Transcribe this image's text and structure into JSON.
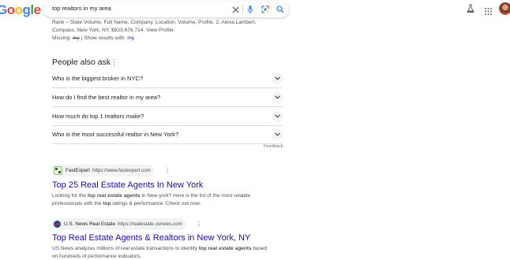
{
  "header": {
    "logo_letters": [
      "G",
      "o",
      "o",
      "g",
      "l",
      "e"
    ],
    "logo_colors": [
      "#4285F4",
      "#EA4335",
      "#FBBC05",
      "#4285F4",
      "#34A853",
      "#EA4335"
    ],
    "query": "top realtors in my area",
    "icons": [
      "close-icon",
      "microphone-icon",
      "lens-icon",
      "search-icon",
      "labs-flask-icon",
      "apps-grid-icon"
    ]
  },
  "snippet": {
    "line1": "Rank – State Volume, Full Name, Company, Location, Volume, Profile. 2, Alexa Lambert,",
    "line2": "Compass, New York, NY, $923,676,714, View Profile.",
    "missing_label": "Missing:",
    "missing_term": "my",
    "show_results": "| Show results with:",
    "show_link": "my"
  },
  "paa": {
    "title": "People also ask",
    "questions": [
      "Who is the biggest broker in NYC?",
      "How do I find the best realtor in my area?",
      "How much do top 1 realtors make?",
      "Who is the most successful realtor in New York?"
    ],
    "feedback": "Feedback"
  },
  "results": [
    {
      "source_name": "FastExpert",
      "source_url": "https://www.fastexpert.com",
      "title": "Top 25 Real Estate Agents In New York",
      "snippet_line1_pre": "Looking for the ",
      "snippet_line1_bold": "top real estate agents",
      "snippet_line1_post": " in New-york? Here is the list of the most reliable",
      "snippet_line2_pre": "professionals with the ",
      "snippet_line2_bold": "top",
      "snippet_line2_post": " ratings & performance. Check out now."
    },
    {
      "source_name": "U.S. News Real Estate",
      "source_url": "https://realestate.usnews.com",
      "title": "Top Real Estate Agents & Realtors in New York, NY",
      "snippet_line1_pre": "US News analyzes millions of real estate transactions to identify ",
      "snippet_line1_bold": "top real estate agents",
      "snippet_line1_post": " based",
      "snippet_line2_pre": "on hundreds of performance indicators.",
      "snippet_line2_bold": "",
      "snippet_line2_post": ""
    }
  ],
  "colors": {
    "link": "#1a0dab",
    "text_secondary": "#4d5156",
    "icon_blue": "#4285F4"
  }
}
